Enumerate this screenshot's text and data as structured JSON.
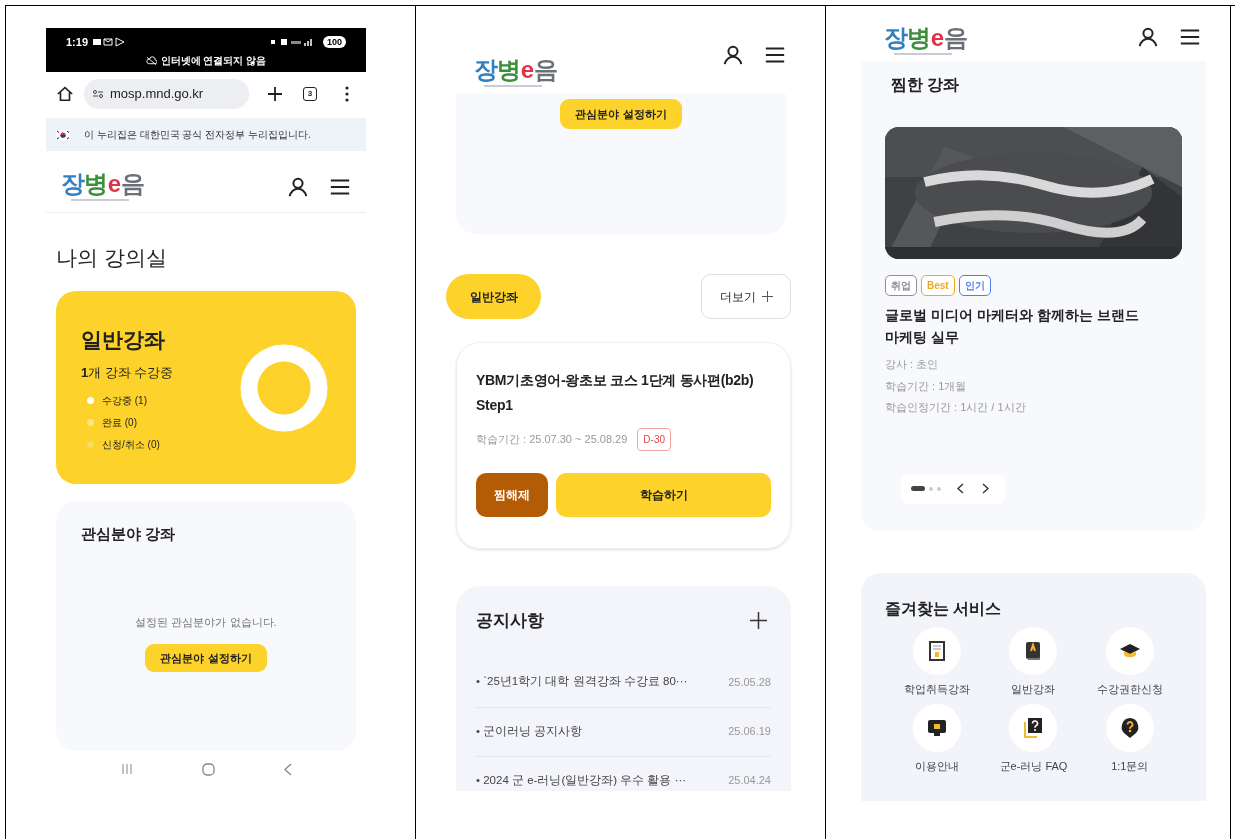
{
  "panel_1": {
    "status_bar": {
      "time": "1:19",
      "battery": "100",
      "notice": "인터넷에 연결되지 않음"
    },
    "browser": {
      "url": "mosp.mnd.go.kr",
      "tab_count": "3"
    },
    "gov_banner": "이 누리집은 대한민국 공식 전자정부 누리집입니다.",
    "logo": "장병e음",
    "page_title": "나의 강의실",
    "course_summary": {
      "title": "일반강좌",
      "count_text": "**1**개 강좌 수강중",
      "legend": [
        {
          "label": "수강중 (1)",
          "color": "#ffffff"
        },
        {
          "label": "완료 (0)",
          "color": "#fde58a"
        },
        {
          "label": "신청/취소 (0)",
          "color": "#fbdc5c"
        }
      ]
    },
    "interest": {
      "title": "관심분야 강좌",
      "empty_text": "설정된 관심분야가 없습니다.",
      "button": "관심분야 설정하기"
    }
  },
  "panel_2": {
    "logo": "장병e음",
    "interest_button": "관심분야 설정하기",
    "section_tab": "일반강좌",
    "more_button": "더보기",
    "course": {
      "title": "YBM기초영어-왕초보 코스 1단계 동사편(b2b) Step1",
      "period": "학습기간 : 25.07.30 ~ 25.08.29",
      "dday": "D-30",
      "unlike_button": "찜해제",
      "study_button": "학습하기"
    },
    "notices": {
      "title": "공지사항",
      "items": [
        {
          "title": "• `25년1학기 대학 원격강좌 수강료 80···",
          "date": "25.05.28"
        },
        {
          "title": "• 군이러닝 공지사항",
          "date": "25.06.19"
        },
        {
          "title": "• 2024 군 e-러닝(일반강좌) 우수 활용 ···",
          "date": "25.04.24"
        }
      ]
    }
  },
  "panel_3": {
    "logo": "장병e음",
    "wishlist": {
      "title": "찜한 강좌",
      "tags": [
        {
          "label": "취업",
          "color": "#8a8f99"
        },
        {
          "label": "Best",
          "color": "#f5a524"
        },
        {
          "label": "인기",
          "color": "#4f7df3"
        }
      ],
      "course_title": "글로벌 미디어 마케터와 함께하는 브랜드 마케팅 실무",
      "meta": [
        "강사 : 초인",
        "학습기간 : 1개월",
        "학습인정기간 : 1시간 / 1시간"
      ],
      "pages": [
        {
          "selected": true
        },
        {
          "selected": false
        },
        {
          "selected": false
        }
      ]
    },
    "services": {
      "title": "즐겨찾는 서비스",
      "items": [
        {
          "label": "학업취득강좌",
          "kind": "certificate"
        },
        {
          "label": "일반강좌",
          "kind": "book"
        },
        {
          "label": "수강권한신청",
          "kind": "cap"
        },
        {
          "label": "이용안내",
          "kind": "monitor"
        },
        {
          "label": "군e-러닝 FAQ",
          "kind": "faq"
        },
        {
          "label": "1:1문의",
          "kind": "question"
        }
      ]
    }
  }
}
